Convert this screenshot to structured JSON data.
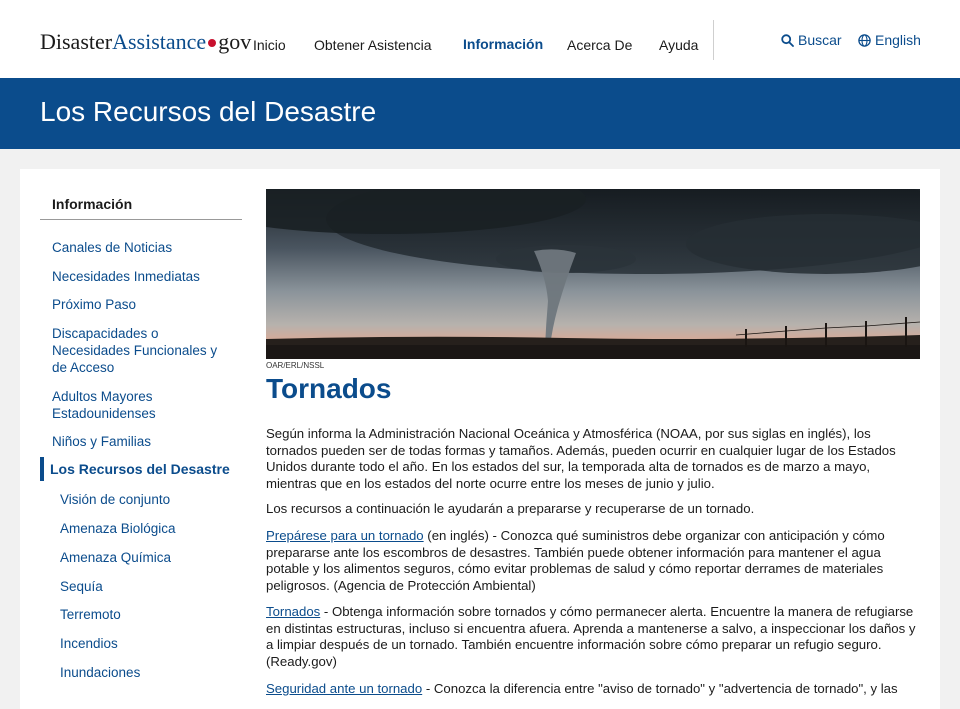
{
  "header": {
    "logo": {
      "part1": "Disaster",
      "part2": "Assistance",
      "part3": "gov"
    },
    "nav": [
      "Inicio",
      "Obtener Asistencia",
      "Información",
      "Acerca De",
      "Ayuda"
    ],
    "search": "Buscar",
    "language": "English"
  },
  "banner": {
    "title": "Los Recursos del Desastre"
  },
  "sidebar": {
    "heading": "Información",
    "items": [
      "Canales de Noticias",
      "Necesidades Inmediatas",
      "Próximo Paso",
      "Discapacidades o Necesidades Funcionales y de Acceso",
      "Adultos Mayores Estadounidenses",
      "Niños y Familias"
    ],
    "current": "Los Recursos del Desastre",
    "subitems": [
      "Visión de conjunto",
      "Amenaza Biológica",
      "Amenaza Química",
      "Sequía",
      "Terremoto",
      "Incendios",
      "Inundaciones"
    ]
  },
  "main": {
    "image_credit": "OAR/ERL/NSSL",
    "title": "Tornados",
    "intro": "Según informa la Administración Nacional Oceánica y Atmosférica (NOAA, por sus siglas en inglés), los tornados pueden ser de todas formas y tamaños. Además, pueden ocurrir en cualquier lugar de los Estados Unidos durante todo el año. En los estados del sur, la temporada alta de tornados es de marzo a mayo, mientras que en los estados del norte ocurre entre los meses de junio y julio.",
    "lead": "Los recursos a continuación le ayudarán a prepararse y recuperarse de un tornado.",
    "resources": [
      {
        "link": "Prepárese para un tornado",
        "text": " (en inglés) - Conozca qué suministros debe organizar con anticipación y cómo prepararse ante los escombros de desastres. También puede obtener información para mantener el agua potable y los alimentos seguros, cómo evitar problemas de salud y cómo reportar derrames de materiales peligrosos. (Agencia de Protección Ambiental)"
      },
      {
        "link": "Tornados",
        "text": " - Obtenga información sobre tornados y cómo permanecer alerta. Encuentre la manera de refugiarse en distintas estructuras, incluso si encuentra afuera. Aprenda a mantenerse a salvo, a inspeccionar los daños y a limpiar después de un tornado. También encuentre información sobre cómo preparar un refugio seguro. (Ready.gov)"
      },
      {
        "link": "Seguridad ante un tornado",
        "text": " - Conozca la diferencia entre \"aviso de tornado\" y \"advertencia de tornado\", y las"
      }
    ]
  },
  "colors": {
    "brand": "#0b4c8c",
    "accent_red": "#c8102e",
    "page_bg": "#f1f1f1"
  }
}
